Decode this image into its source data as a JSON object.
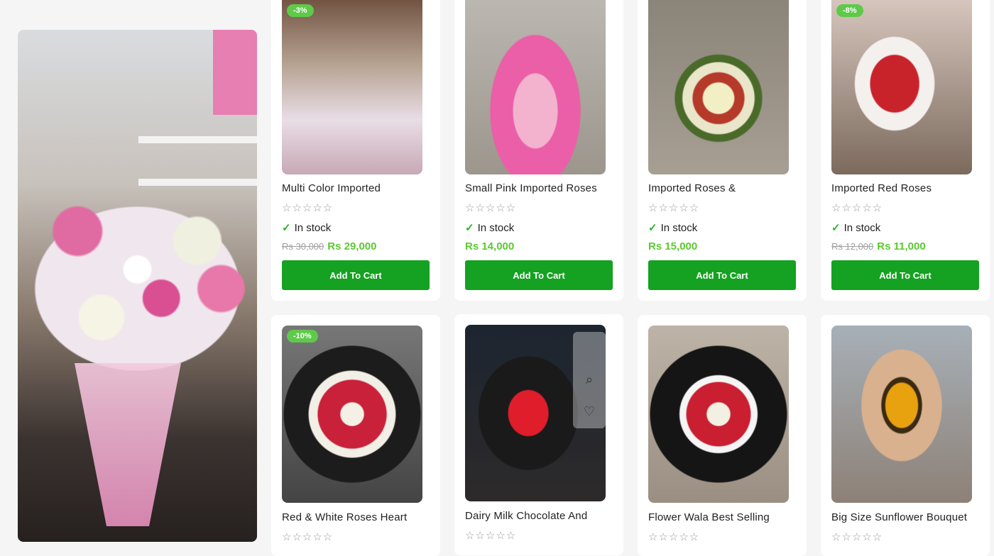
{
  "colors": {
    "accent": "#15a121",
    "price": "#5cc931",
    "badge": "#5fc94a"
  },
  "products": [
    {
      "title": "Multi Color Imported",
      "badge": "-3%",
      "stars": "☆☆☆☆☆",
      "stock": "In stock",
      "old_price": "Rs 30,000",
      "price": "Rs 29,000",
      "button": "Add To Cart"
    },
    {
      "title": "Small Pink Imported Roses",
      "stars": "☆☆☆☆☆",
      "stock": "In stock",
      "price": "Rs 14,000",
      "button": "Add To Cart"
    },
    {
      "title": "Imported Roses &",
      "stars": "☆☆☆☆☆",
      "stock": "In stock",
      "price": "Rs 15,000",
      "button": "Add To Cart"
    },
    {
      "title": "Imported Red Roses",
      "badge": "-8%",
      "stars": "☆☆☆☆☆",
      "stock": "In stock",
      "old_price": "Rs 12,000",
      "price": "Rs 11,000",
      "button": "Add To Cart"
    },
    {
      "title": "Red & White Roses Heart",
      "badge": "-10%",
      "stars": "☆☆☆☆☆"
    },
    {
      "title": "Dairy Milk Chocolate And",
      "stars": "☆☆☆☆☆"
    },
    {
      "title": "Flower Wala Best Selling",
      "stars": "☆☆☆☆☆"
    },
    {
      "title": "Big Size Sunflower Bouquet",
      "stars": "☆☆☆☆☆"
    }
  ],
  "icons": {
    "check": "check-icon",
    "search": "search-icon",
    "heart": "heart-icon"
  }
}
